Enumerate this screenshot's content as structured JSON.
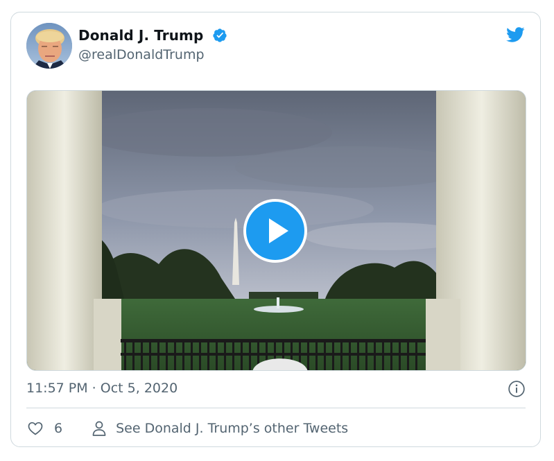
{
  "author": {
    "name": "Donald J. Trump",
    "handle": "@realDonaldTrump",
    "verified": true
  },
  "media": {
    "type": "video",
    "play_icon": "play-icon"
  },
  "tweet": {
    "timestamp": "11:57 PM · Oct 5, 2020"
  },
  "actions": {
    "like_count": "6",
    "other_tweets_label": "See Donald J. Trump’s other Tweets"
  },
  "colors": {
    "twitter_blue": "#1d9bf0",
    "text_secondary": "#536471",
    "border": "#cfd9de"
  }
}
